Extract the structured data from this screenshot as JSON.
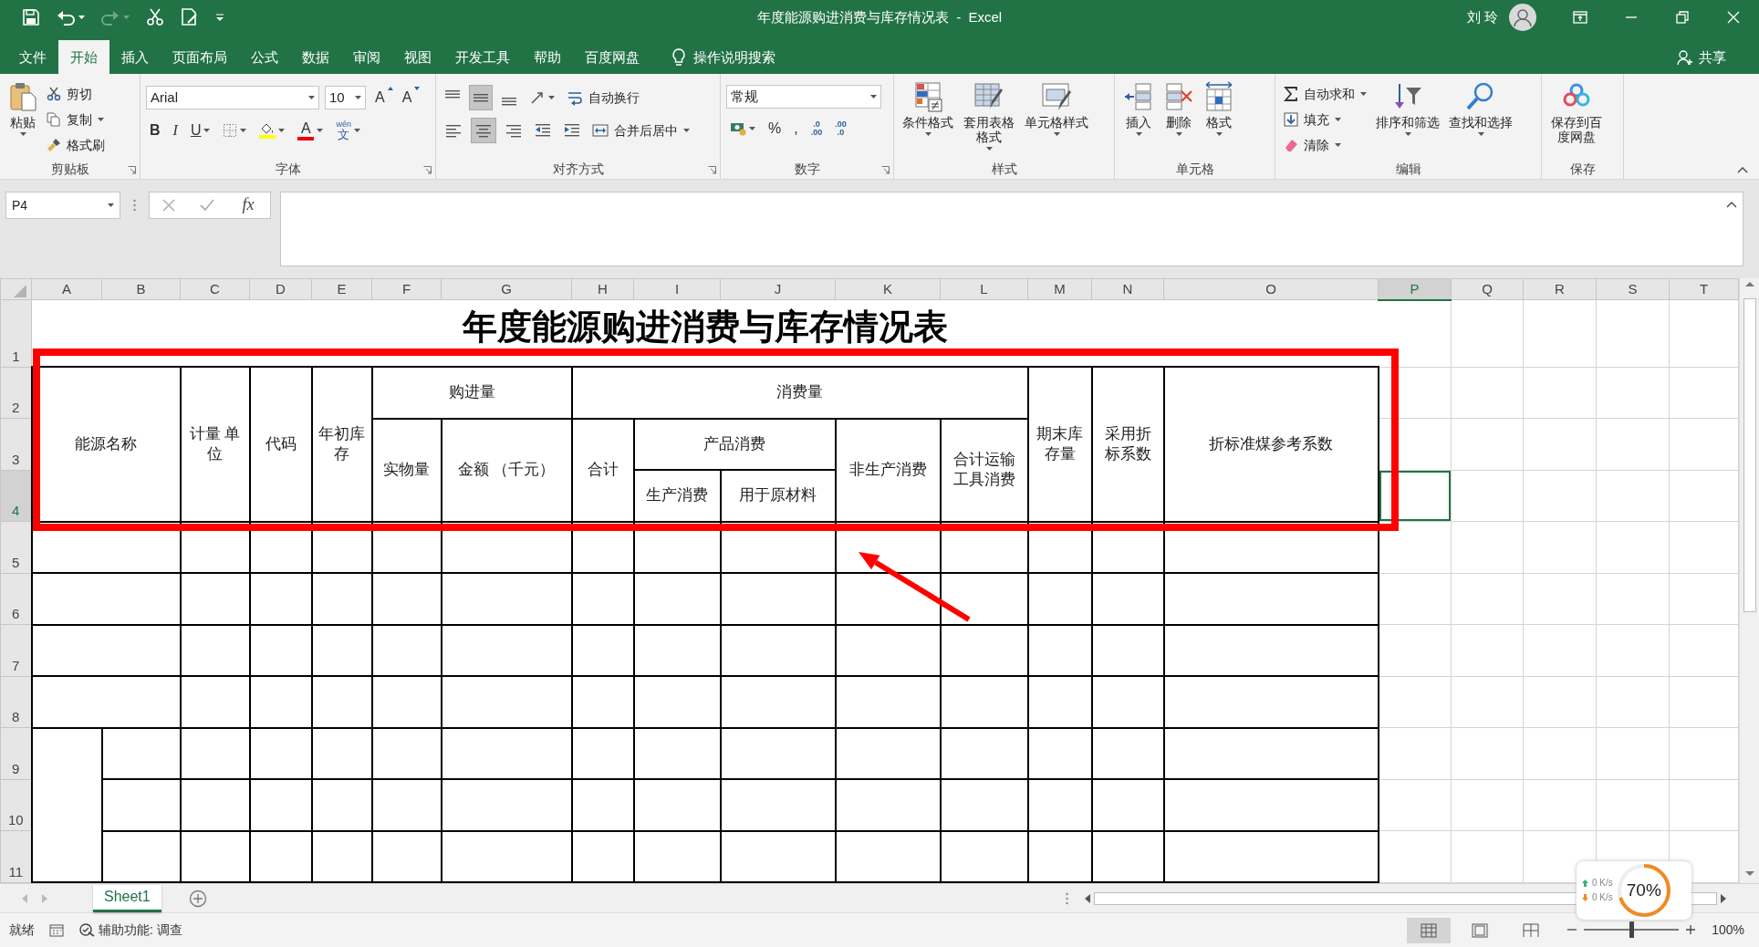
{
  "window": {
    "title": "年度能源购进消费与库存情况表  -  Excel",
    "user": "刘 玲"
  },
  "menu_tabs": [
    {
      "label": "文件",
      "selected": false
    },
    {
      "label": "开始",
      "selected": true
    },
    {
      "label": "插入",
      "selected": false
    },
    {
      "label": "页面布局",
      "selected": false
    },
    {
      "label": "公式",
      "selected": false
    },
    {
      "label": "数据",
      "selected": false
    },
    {
      "label": "审阅",
      "selected": false
    },
    {
      "label": "视图",
      "selected": false
    },
    {
      "label": "开发工具",
      "selected": false
    },
    {
      "label": "帮助",
      "selected": false
    },
    {
      "label": "百度网盘",
      "selected": false
    }
  ],
  "tell_me": "操作说明搜索",
  "share": "共享",
  "ribbon": [
    {
      "label": "剪贴板",
      "launcher": true,
      "items": [
        {
          "kind": "large",
          "label": "粘贴",
          "dropdown": true
        },
        {
          "kind": "small",
          "label": "剪切",
          "dropdown": false
        },
        {
          "kind": "small",
          "label": "复制",
          "dropdown": true
        },
        {
          "kind": "small",
          "label": "格式刷",
          "dropdown": false
        }
      ]
    },
    {
      "label": "字体",
      "launcher": true,
      "rows": [
        {
          "items": [
            {
              "kind": "combo",
              "value": "Arial"
            },
            {
              "kind": "combo",
              "value": "10"
            },
            {
              "kind": "glyph",
              "label": "A",
              "dropdown": false
            },
            {
              "kind": "glyph",
              "label": "A",
              "dropdown": false
            }
          ]
        },
        {
          "items": [
            {
              "kind": "glyph",
              "label": "B",
              "dropdown": false
            },
            {
              "kind": "glyph",
              "label": "I",
              "dropdown": false
            },
            {
              "kind": "glyph",
              "label": "U",
              "dropdown": true
            },
            {
              "kind": "icon",
              "dropdown": true,
              "selected": false
            },
            {
              "kind": "icon",
              "dropdown": true,
              "selected": false
            },
            {
              "kind": "glyph",
              "label": "A",
              "dropdown": true
            },
            {
              "kind": "phonetic",
              "ruby": "wén",
              "label": "文",
              "dropdown": true
            }
          ]
        }
      ]
    },
    {
      "label": "对齐方式",
      "launcher": true,
      "rows": [
        {
          "items": [
            {
              "kind": "icon",
              "selected": false,
              "dropdown": false
            },
            {
              "kind": "icon",
              "selected": true,
              "dropdown": false
            },
            {
              "kind": "icon",
              "selected": false,
              "dropdown": false
            },
            {
              "kind": "icon",
              "selected": false,
              "dropdown": true
            },
            {
              "kind": "small",
              "label": "自动换行",
              "dropdown": false
            }
          ]
        },
        {
          "items": [
            {
              "kind": "icon",
              "selected": false,
              "dropdown": false
            },
            {
              "kind": "icon",
              "selected": true,
              "dropdown": false
            },
            {
              "kind": "icon",
              "selected": false,
              "dropdown": false
            },
            {
              "kind": "icon",
              "selected": false,
              "dropdown": false
            },
            {
              "kind": "icon",
              "selected": false,
              "dropdown": false
            },
            {
              "kind": "small",
              "label": "合并后居中",
              "dropdown": true
            }
          ]
        }
      ]
    },
    {
      "label": "数字",
      "launcher": true,
      "rows": [
        {
          "items": [
            {
              "kind": "combo",
              "value": "常规"
            }
          ]
        },
        {
          "items": [
            {
              "kind": "icon",
              "selected": false,
              "dropdown": true
            },
            {
              "kind": "glyph",
              "label": "%",
              "dropdown": false
            },
            {
              "kind": "glyph",
              "label": ",",
              "dropdown": false
            },
            {
              "kind": "stack",
              "top": ".0",
              "bottom": ".00"
            },
            {
              "kind": "stack",
              "top": ".00",
              "bottom": ".0"
            }
          ]
        }
      ]
    },
    {
      "label": "样式",
      "launcher": false,
      "items": [
        {
          "kind": "large",
          "label": "条件格式",
          "dropdown": true
        },
        {
          "kind": "large",
          "label": "套用表格格式",
          "dropdown": true
        },
        {
          "kind": "large",
          "label": "单元格样式",
          "dropdown": true
        }
      ]
    },
    {
      "label": "单元格",
      "launcher": false,
      "items": [
        {
          "kind": "large",
          "label": "插入",
          "dropdown": true
        },
        {
          "kind": "large",
          "label": "删除",
          "dropdown": true
        },
        {
          "kind": "large",
          "label": "格式",
          "dropdown": true
        }
      ]
    },
    {
      "label": "编辑",
      "launcher": false,
      "items": [
        {
          "kind": "small",
          "label": "自动求和",
          "dropdown": true
        },
        {
          "kind": "small",
          "label": "填充",
          "dropdown": true
        },
        {
          "kind": "small",
          "label": "清除",
          "dropdown": true
        },
        {
          "kind": "large",
          "label": "排序和筛选",
          "dropdown": true
        },
        {
          "kind": "large",
          "label": "查找和选择",
          "dropdown": true
        }
      ]
    },
    {
      "label": "保存",
      "launcher": false,
      "items": [
        {
          "kind": "large",
          "label": "保存到百度网盘",
          "dropdown": false
        }
      ]
    }
  ],
  "formula_bar": {
    "name_box": "P4",
    "function_label": "fx"
  },
  "columns": [
    {
      "label": "A",
      "selected": false
    },
    {
      "label": "B",
      "selected": false
    },
    {
      "label": "C",
      "selected": false
    },
    {
      "label": "D",
      "selected": false
    },
    {
      "label": "E",
      "selected": false
    },
    {
      "label": "F",
      "selected": false
    },
    {
      "label": "G",
      "selected": false
    },
    {
      "label": "H",
      "selected": false
    },
    {
      "label": "I",
      "selected": false
    },
    {
      "label": "J",
      "selected": false
    },
    {
      "label": "K",
      "selected": false
    },
    {
      "label": "L",
      "selected": false
    },
    {
      "label": "M",
      "selected": false
    },
    {
      "label": "N",
      "selected": false
    },
    {
      "label": "O",
      "selected": false
    },
    {
      "label": "P",
      "selected": true
    },
    {
      "label": "Q",
      "selected": false
    },
    {
      "label": "R",
      "selected": false
    },
    {
      "label": "S",
      "selected": false
    },
    {
      "label": "T",
      "selected": false
    }
  ],
  "rows": [
    {
      "label": "1",
      "selected": false
    },
    {
      "label": "2",
      "selected": false
    },
    {
      "label": "3",
      "selected": false
    },
    {
      "label": "4",
      "selected": true
    },
    {
      "label": "5",
      "selected": false
    },
    {
      "label": "6",
      "selected": false
    },
    {
      "label": "7",
      "selected": false
    },
    {
      "label": "8",
      "selected": false
    },
    {
      "label": "9",
      "selected": false
    },
    {
      "label": "10",
      "selected": false
    },
    {
      "label": "11",
      "selected": false
    }
  ],
  "sheet": {
    "title": "年度能源购进消费与库存情况表",
    "header_cells": [
      "能源名称",
      "计量 单位",
      "代码",
      "年初库存",
      "购进量",
      "消费量",
      "期末库存量",
      "采用折标系数",
      "折标准煤参考系数",
      "实物量",
      "金额 （千元）",
      "合计",
      "产品消费",
      "非生产消费",
      "合计运输工具消费",
      "生产消费",
      "用于原材料"
    ]
  },
  "sheet_tabs": [
    {
      "label": "Sheet1",
      "selected": true
    }
  ],
  "status_bar": {
    "ready": "就绪",
    "accessibility": "辅助功能: 调查",
    "views": [
      {
        "selected": true
      },
      {
        "selected": false
      },
      {
        "selected": false
      }
    ],
    "zoom": {
      "level": 0.5,
      "reading": "100%"
    }
  },
  "speed_widget": {
    "upload": "0 K/s",
    "download": "0 K/s",
    "reading": "70%",
    "level": 0.7
  }
}
